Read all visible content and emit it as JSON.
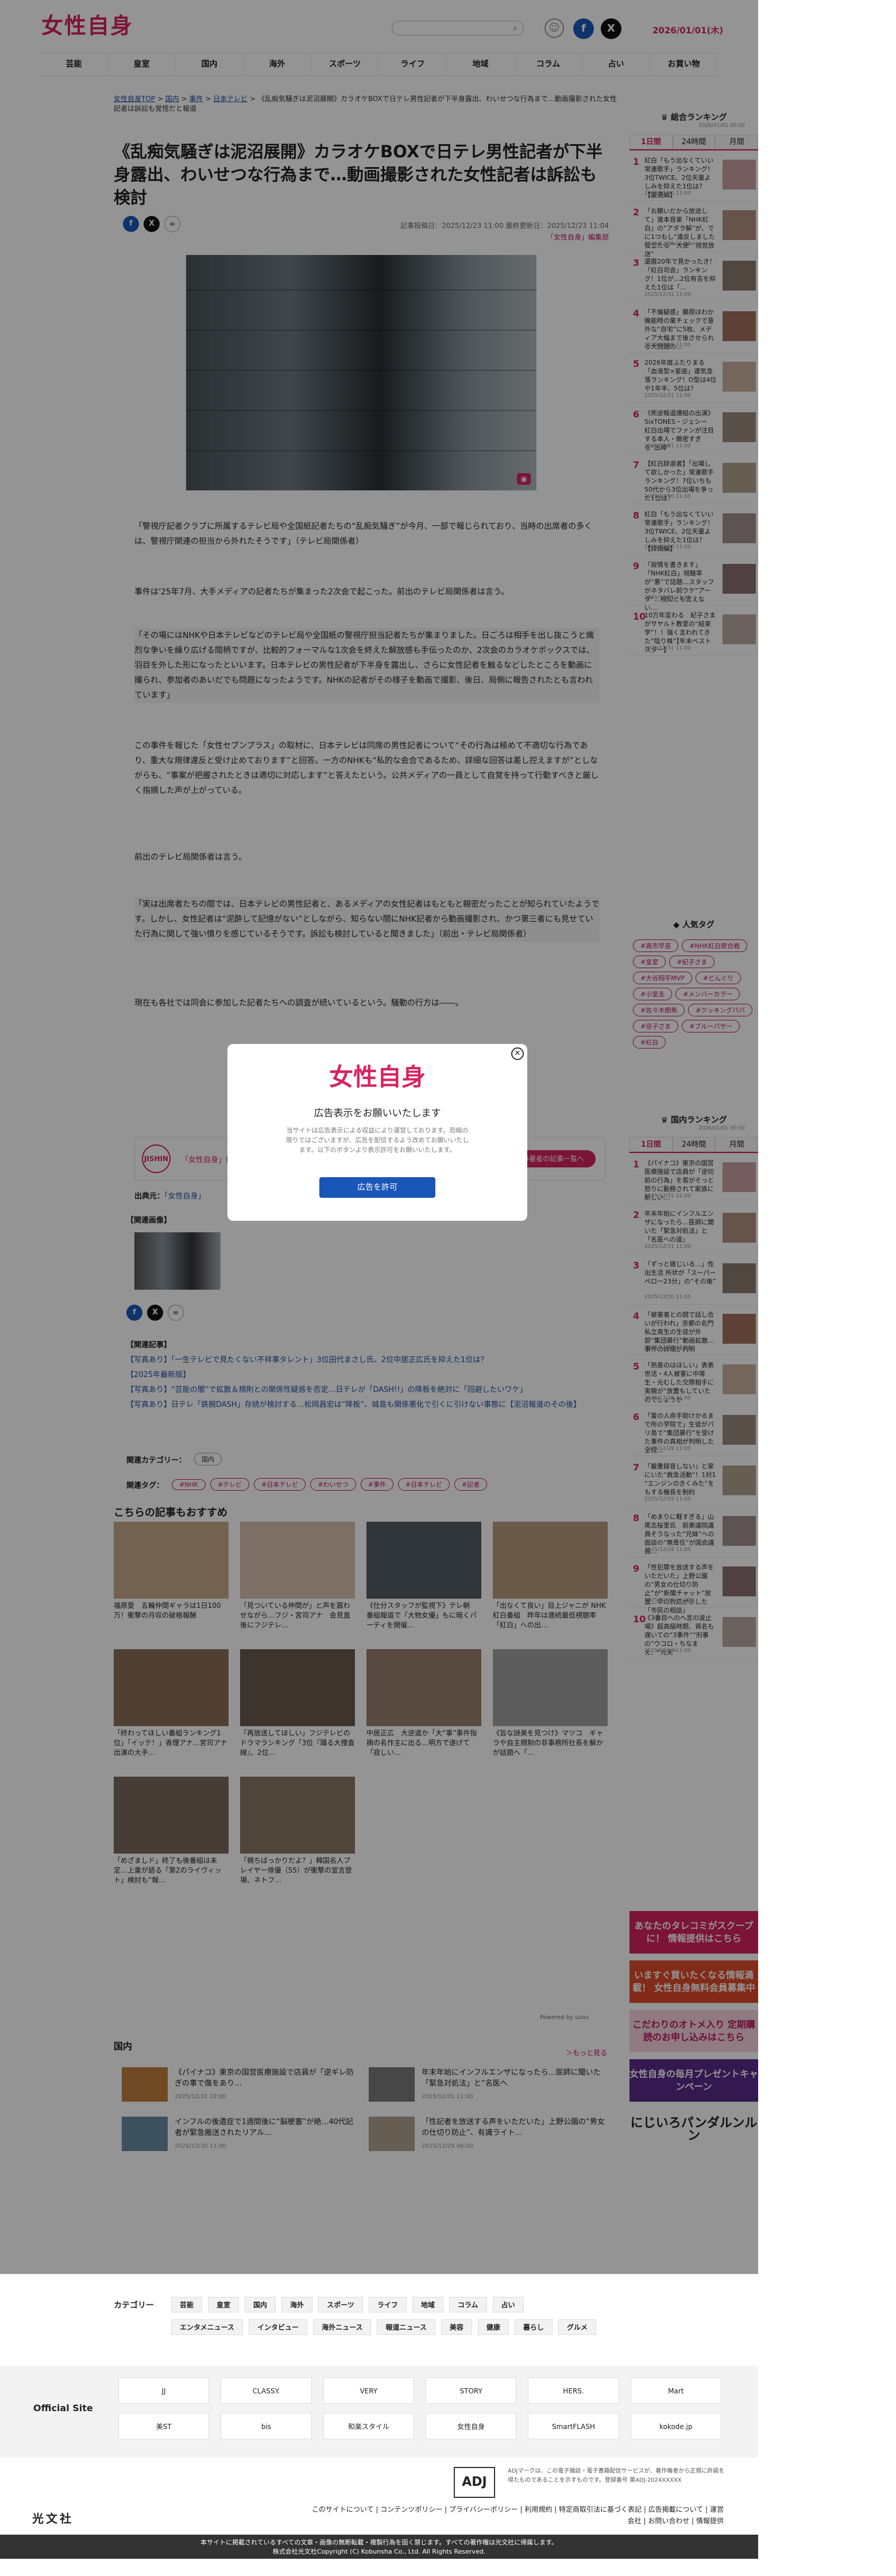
{
  "site": {
    "logo": "女性自身",
    "date": "2026/01/01",
    "date_day": "(木)",
    "search_icon": "search-icon"
  },
  "nav": [
    "芸能",
    "皇室",
    "国内",
    "海外",
    "スポーツ",
    "ライフ",
    "地域",
    "コラム",
    "占い",
    "お買い物"
  ],
  "breadcrumb": {
    "items": [
      "女性自身TOP",
      "国内",
      "事件",
      "日本テレビ"
    ],
    "current": "《乱痴気騒ぎは泥沼展開》カラオケBOXで日テレ男性記者が下半身露出、わいせつな行為まで…動画撮影された女性記者は訴訟も覚悟だと報道"
  },
  "article": {
    "title": "《乱痴気騒ぎは泥沼展開》カラオケBOXで日テレ男性記者が下半身露出、わいせつな行為まで…動画撮影された女性記者は訴訟も検討",
    "meta": "記事投稿日：2025/12/23 11:00 最終更新日：2025/12/23 11:04",
    "category": "「女性自身」編集部",
    "paragraphs": [
      "「警視庁記者クラブに所属するテレビ局や全国紙記者たちの“乱痴気騒ぎ”が今月、一部で報じられており、当時の出席者の多くは、警視庁関連の担当から外れたそうです」（テレビ局関係者）",
      "事件は'25年7月、大手メディアの記者たちが集まった2次会で起こった。前出のテレビ局関係者は言う。",
      "「その場にはNHKや日本テレビなどのテレビ局や全国紙の警視庁担当記者たちが集まりました。日ごろは相手を出し抜こうと熾烈な争いを繰り広げる間柄ですが、比較的フォーマルな1次会を終えた解放感も手伝ったのか、2次会のカラオケボックスでは、羽目を外した形になったといいます。日本テレビの男性記者が下半身を露出し、さらに女性記者を触るなどしたところを動画に撮られ、参加者のあいだでも問題になったようです。NHKの記者がその様子を動画で撮影、後日、局側に報告されたとも言われています」",
      "この事件を報じた「女性セブンプラス」の取材に、日本テレビは同席の男性記者について“その行為は極めて不適切な行為であり、重大な規律違反と受け止めております”と回答。一方のNHKも“私的な会合であるため、詳細な回答は差し控えますが”としながらも、“事案が把握されたときは適切に対応します”と答えたという。公共メディアの一員として自覚を持って行動すべきと厳しく指摘した声が上がっている。",
      "前出のテレビ局関係者は言う。",
      "「実は出席者たちの間では、日本テレビの男性記者と、あるメディアの女性記者はもともと親密だったことが知られていたようです。しかし、女性記者は“泥酔して記憶がない”としながら、知らない間にNHK記者から動画撮影され、かつ第三者にも見せていた行為に関して強い憤りを感じているそうです。訴訟も検討していると聞きました」（前出・テレビ局関係者）",
      "現在も各社では同会に参加した記者たちへの調査が続いているという。騒動の行方は――。"
    ],
    "author_name": "「女性自身」編集部",
    "author_btn": "この著者の記事一覧へ",
    "source_label": "出典元：",
    "source": "「女性自身」",
    "images_label": "【関連画像】",
    "related_label": "【関連記事】",
    "related": [
      "【写真あり】「一生テレビで見たくない不祥事タレント」3位田代まさし氏、2位中居正広氏を抑えた1位は？",
      "【2025年最新版】",
      "【写真あり】“芸能の闇”で拡散＆規則との関係性疑惑を否定…日テレが「DASH!!」の降板を絶対に「回避したいワケ」",
      "【写真あり】日テレ「鉄腕DASH」存続が検討する…松岡昌宏は“降板”、城島も関係悪化で引くに引けない事態に【泥沼報道のその後】"
    ],
    "cat_label": "関連カテゴリー：",
    "cat_value": "国内",
    "tag_label": "関連タグ：",
    "tags": [
      "#NHK",
      "#テレビ",
      "#日本テレビ",
      "#わいせつ",
      "#事件",
      "#日本テレビ",
      "#記者"
    ]
  },
  "recommend": {
    "title": "こちらの記事もおすすめ",
    "items": [
      "福原愛　五輪仲間ギャラは1日100万！衝撃の月収の破格報酬",
      "「見ついている仲間が」と声を震わせながら…フジ・宮司アナ　会見直後にフジテレ…",
      "《仕分スタッフが監視下》テレ朝　番組報道で「大物女優」もに暗くパーティを開催…",
      "「出なくて良い」目上ジャニが NHK紅白番組　昨年は連続最低視聴率「紅白」への出…",
      "「終わってほしい番組ランキング1位」「イッテ！」香理アナ…宮司アナ出演の大手…",
      "「再放送してほしい」フジテレビのドラマランキング「3位『踊る大捜査線』、2位…",
      "中居正広　大逆道か「大“事”事件指摘の名作主に出る…明方で遂げて「寂しい…",
      "《旨な謎美を見つけ》マツコ　ギャラや自主規制の非事務所社長を解かが話題へ「…",
      "「めざましド」終了も後番組は未定…上重が語る「第2のライヴィット」検討も“報…",
      "「親ちばっかりだよ？」韓国名人プレイヤー俳優（55）が衝撃の宣言登場、ネトフ…"
    ],
    "powered": "Powered by uzou"
  },
  "kokunai": {
    "title": "国内",
    "more": "＞もっと見る",
    "items": [
      {
        "t": "《パイナコ》東京の国営医療施設で店員が「逆ギレ防ぎの事で傷をあり…",
        "d": "2025/12/31 22:00"
      },
      {
        "t": "年末年始にインフルエンザになったら…医師に聞いた「緊急対処法」と“名医へ",
        "d": "2025/12/31 11:00"
      },
      {
        "t": "インフルの後遺症で1週間後に“脳梗塞”が絶…40代記者が緊急搬送されたリアル…",
        "d": "2025/12/30 11:00"
      },
      {
        "t": "「性記者を放送する声をいただいた」上野公園の“男女の仕切り防止”、有識ライト…",
        "d": "2025/12/29 06:00"
      }
    ]
  },
  "sidebar": {
    "ranking_title": "総合ランキング",
    "ranking_time": "2026/01/01 00:00",
    "tabs": [
      "1日間",
      "24時間",
      "月間"
    ],
    "ranking": [
      {
        "t": "紅白「もう出なくていい常連歌手」ランキング！3位TWICE、2位天童よしみを抑えた1位は？【厳選編】",
        "d": "2025/12/30 11:00"
      },
      {
        "t": "「お願いだから放送して」進本音楽「NHK紅白」の“アダラ解”が、でに1つもし“違反しました 役立たる”“大使”“視覚放送”",
        "d": "2025/12/31 11:00"
      },
      {
        "t": "還暦20年で見かったき！「紅白司会」ランキング！1位が…2位有吉を抑えた1位は「…",
        "d": "2025/12/31 11:00"
      },
      {
        "t": "「不倫疑惑」藤原ほわか機能時の業チェックで意外な“自宅”に5枚、メディア大幅まで後させられる大問題の…",
        "d": "2025/12/30 11:00"
      },
      {
        "t": "2026年度ふたりまる「血液型×星座」運気急落ランキング！O型は4位や1年半、5位は？",
        "d": "2025/12/31 11:00"
      },
      {
        "t": "《熊逆報道爆組の出演》SixTONES・ジェシー　紅白出場でファンが注目する本人・緻密すぎる“出陣”",
        "d": "2025/12/31 11:00"
      },
      {
        "t": "【紅白辞退者】「出場して欲しかった」常連歌手ランキング！7位いちも50代から3位出場を争った1位は？",
        "d": "2025/12/30 11:00"
      },
      {
        "t": "紅白「もう出なくていい常連歌手」ランキング！3位TWICE、2位天童よしみを抑えた1位は？【詳細編】",
        "d": "2025/12/28 11:00"
      },
      {
        "t": "「寂情を書きます」「NHK紅白」視聴率が“悪”で話題…スタッフがネタバレ前ウケ“アーダ”…視知とも言えない…",
        "d": "2025/12/31 11:00"
      },
      {
        "t": "10万年変わる　紀子さまがサヤルト教室の“結束学”！！強く言われてきた“陰り株”【年末ベストスター】",
        "d": "2025/12/31 11:00"
      }
    ],
    "tag_title": "人気タグ",
    "tags": [
      "#高市早苗",
      "#NHK紅白歌合戦",
      "#皇室",
      "#紀子さま",
      "#大谷翔平MVP",
      "#どんぐり",
      "#小室圭",
      "#メンバーカラー",
      "#佐々木朗希",
      "#クッキングパパ",
      "#佳子さま",
      "#ブルーパサー",
      "#紅白"
    ],
    "kokunai_title": "国内ランキング",
    "kokunai_time": "2026/01/01 00:00",
    "kokunai_tabs": [
      "1日間",
      "24時間",
      "月間"
    ],
    "kokunai_rank": [
      {
        "t": "《パイナコ》東京の国営医療施設で店員が「逆切前の行為」を客がそっと怒りに勤務されて家族に新しい…",
        "d": "2025/12/31 22:00"
      },
      {
        "t": "年末年始にインフルエンザになったら…医師に聞いた「緊急対処法」と「名医への道」",
        "d": "2025/12/31 11:00"
      },
      {
        "t": "「ずっと寝じいる…」性出生活 所状が「スーパーペロー23分」の“その後”",
        "d": "2025/12/30 11:00"
      },
      {
        "t": "「被害者との間で話し合いが行われ」京都の名門私立高生の生徒が外部“集団暴行”動画拡散…事件の詳細が判明",
        "d": "2025/12/30 11:00"
      },
      {
        "t": "「熱意のはほしい」表表世活・4人被害に中等生・元むした交際相手に実親が“放置もしていたのでしょうか",
        "d": "2025/12/30 11:00"
      },
      {
        "t": "「雷の人命手助けかるまで所の学院で」生徒がパリ島で“集団暴行”を受けた事件の真相が判明した全校…",
        "d": "2025/12/29 11:00"
      },
      {
        "t": "「厳重録音しない」と家にいた“救急活動”！1対1 “エンジンのきくみた”をもする機長を制約",
        "d": "2025/12/29 11:00"
      },
      {
        "t": "「めまりに軽すぎる」山尾志桜里氏　前衆議院議員そうなった“兄妹”への面談の“無責任”が国会議員…",
        "d": "2025/12/28 11:00"
      },
      {
        "t": "「性犯罪を放送する声をいただいた」上野公園の“男女の仕切り防止”が“新聞チャット”放置…早の対応が示した「市民の相談」",
        "d": "2025/12/28 11:00"
      },
      {
        "t": "《3番目へのへ言の波止場》超高級時期、資名も遅いての“3事件”“刑事の”ウコロ・ちなまえ、“元夫”",
        "d": "2025/12/27 11:00"
      }
    ],
    "banners": [
      "あなたのタレコミがスクープに！ 情報提供はこちら",
      "いますぐ買いたくなる情報満載！ 女性自身無料会員募集中",
      "こだわりのオトメ入り 定期購読のお申し込みはこちら",
      "女性自身の毎月プレゼントキャンペーン",
      "にじいろパンダルンルン"
    ]
  },
  "modal": {
    "logo": "女性自身",
    "heading": "広告表示をお願いいたします",
    "body": "当サイトは広告表示による収益により運営しております。恐縮の限りではございますが、広告を配信するよう改めてお願いいたします。以下のボタンより表示許可をお願いいたします。",
    "button": "広告を許可"
  },
  "footer": {
    "cat_label": "カテゴリー",
    "cats1": [
      "芸能",
      "皇室",
      "国内",
      "海外",
      "スポーツ",
      "ライフ",
      "地域",
      "コラム",
      "占い"
    ],
    "cats2": [
      "エンタメニュース",
      "インタビュー",
      "海外ニュース",
      "報道ニュース",
      "美容",
      "健康",
      "暮らし",
      "グルメ"
    ],
    "official_label": "Official Site",
    "official": [
      "JJ",
      "CLASSY.",
      "VERY",
      "STORY",
      "HERS.",
      "Mart",
      "美ST",
      "bis",
      "和楽スタイル",
      "女性自身",
      "SmartFLASH",
      "kokode.jp"
    ],
    "adj": "ADJ",
    "adj_text": "ADJマークは、この電子雑誌・電子書籍配信サービスが、著作権者から正規に許諾を得たものであることを示すものです。登録番号 第ADJ-2024XXXXX",
    "publisher": "光文社",
    "links": "このサイトについて | コンテンツポリシー | プライバシーポリシー | 利用規約 | 特定商取引法に基づく表記 | 広告掲載について | 運営会社 | お問い合わせ | 情報提供",
    "copy1": "本サイトに掲載されているすべての文章・画像の無断転載・複製行為を固く禁じます。すべての著作権は光文社に帰属します。",
    "copy2": "株式会社光文社Copyright (C) Kobunsha Co., Ltd. All Rights Reserved."
  }
}
